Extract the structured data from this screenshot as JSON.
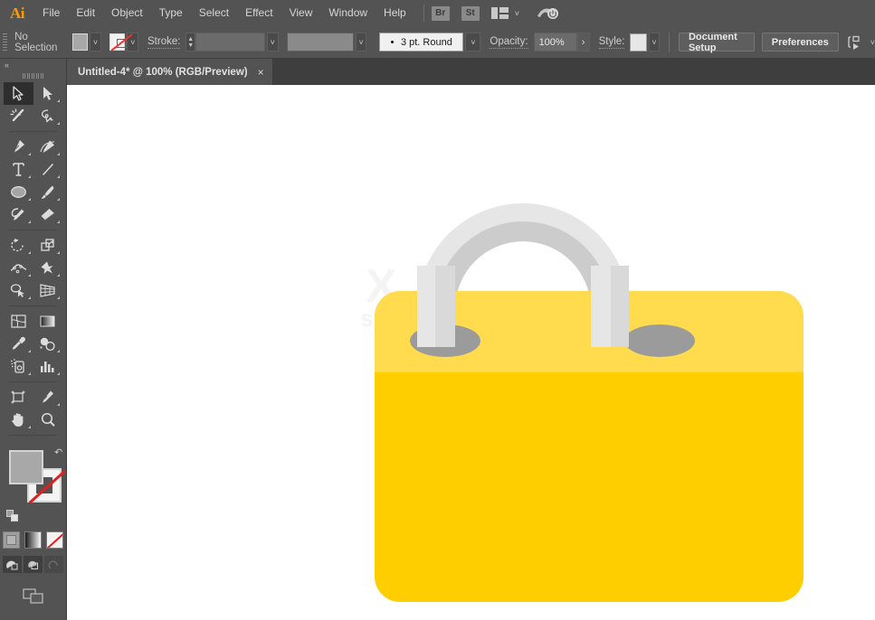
{
  "app": {
    "name": "Adobe Illustrator",
    "logo_text": "Ai"
  },
  "menubar": {
    "items": [
      {
        "label": "File"
      },
      {
        "label": "Edit"
      },
      {
        "label": "Object"
      },
      {
        "label": "Type"
      },
      {
        "label": "Select"
      },
      {
        "label": "Effect"
      },
      {
        "label": "View"
      },
      {
        "label": "Window"
      },
      {
        "label": "Help"
      }
    ],
    "bridge_label": "Br",
    "stock_label": "St",
    "workspace_icon": "workspace-layout-icon",
    "workspace_chevron": "˅",
    "cc_icon": "creative-cloud-icon"
  },
  "controlbar": {
    "selection_status": "No Selection",
    "fill_swatch_name": "fill-color-swatch",
    "fill_color": "#a8a8a8",
    "stroke_swatch_name": "stroke-color-swatch",
    "stroke_label": "Stroke:",
    "stroke_weight_value": "",
    "stroke_profile_value": "",
    "brush_value": "3 pt. Round",
    "opacity_label": "Opacity:",
    "opacity_value": "100%",
    "opacity_arrow": "›",
    "style_label": "Style:",
    "document_setup_label": "Document Setup",
    "preferences_label": "Preferences",
    "align_icon": "align-objects-icon",
    "chevron": "˅"
  },
  "tabbar": {
    "document_title": "Untitled-4* @ 100% (RGB/Preview)",
    "close_label": "×"
  },
  "tools": {
    "collapse_label": "«",
    "items": [
      {
        "name": "selection-tool",
        "active": true
      },
      {
        "name": "direct-selection-tool",
        "active": false
      },
      {
        "name": "magic-wand-tool",
        "active": false
      },
      {
        "name": "lasso-tool",
        "active": false
      },
      {
        "name": "pen-tool",
        "active": false
      },
      {
        "name": "curvature-tool",
        "active": false
      },
      {
        "name": "type-tool",
        "active": false
      },
      {
        "name": "line-segment-tool",
        "active": false
      },
      {
        "name": "ellipse-tool",
        "active": false
      },
      {
        "name": "paintbrush-tool",
        "active": false
      },
      {
        "name": "shaper-tool",
        "active": false
      },
      {
        "name": "eraser-tool",
        "active": false
      },
      {
        "name": "rotate-tool",
        "active": false
      },
      {
        "name": "scale-tool",
        "active": false
      },
      {
        "name": "width-tool",
        "active": false
      },
      {
        "name": "free-transform-tool",
        "active": false
      },
      {
        "name": "shape-builder-tool",
        "active": false
      },
      {
        "name": "perspective-grid-tool",
        "active": false
      },
      {
        "name": "mesh-tool",
        "active": false
      },
      {
        "name": "gradient-tool",
        "active": false
      },
      {
        "name": "eyedropper-tool",
        "active": false
      },
      {
        "name": "blend-tool",
        "active": false
      },
      {
        "name": "symbol-sprayer-tool",
        "active": false
      },
      {
        "name": "column-graph-tool",
        "active": false
      },
      {
        "name": "artboard-tool",
        "active": false
      },
      {
        "name": "slice-tool",
        "active": false
      },
      {
        "name": "hand-tool",
        "active": false
      },
      {
        "name": "zoom-tool",
        "active": false
      }
    ],
    "fill_color": "#a8a8a8",
    "stroke_is_none": true,
    "swap_icon": "swap-fill-stroke-icon",
    "default_icon": "default-fill-stroke-icon",
    "color_mode_icon": "color-mode-button",
    "gradient_mode_icon": "gradient-mode-button",
    "none_mode_icon": "none-mode-button",
    "draw_normal_icon": "draw-normal-button",
    "draw_behind_icon": "draw-behind-button",
    "draw_inside_icon": "draw-inside-button",
    "screen_mode_icon": "change-screen-mode-button"
  },
  "artwork": {
    "name": "padlock-illustration",
    "body_color": "#ffce00",
    "body_top_color": "#ffdb4d",
    "shackle_outer_color": "#e6e6e6",
    "shackle_inner_color": "#cccccc",
    "hole_color": "#9b9b9b",
    "watermark_mark": "X",
    "watermark_text": "syste"
  }
}
